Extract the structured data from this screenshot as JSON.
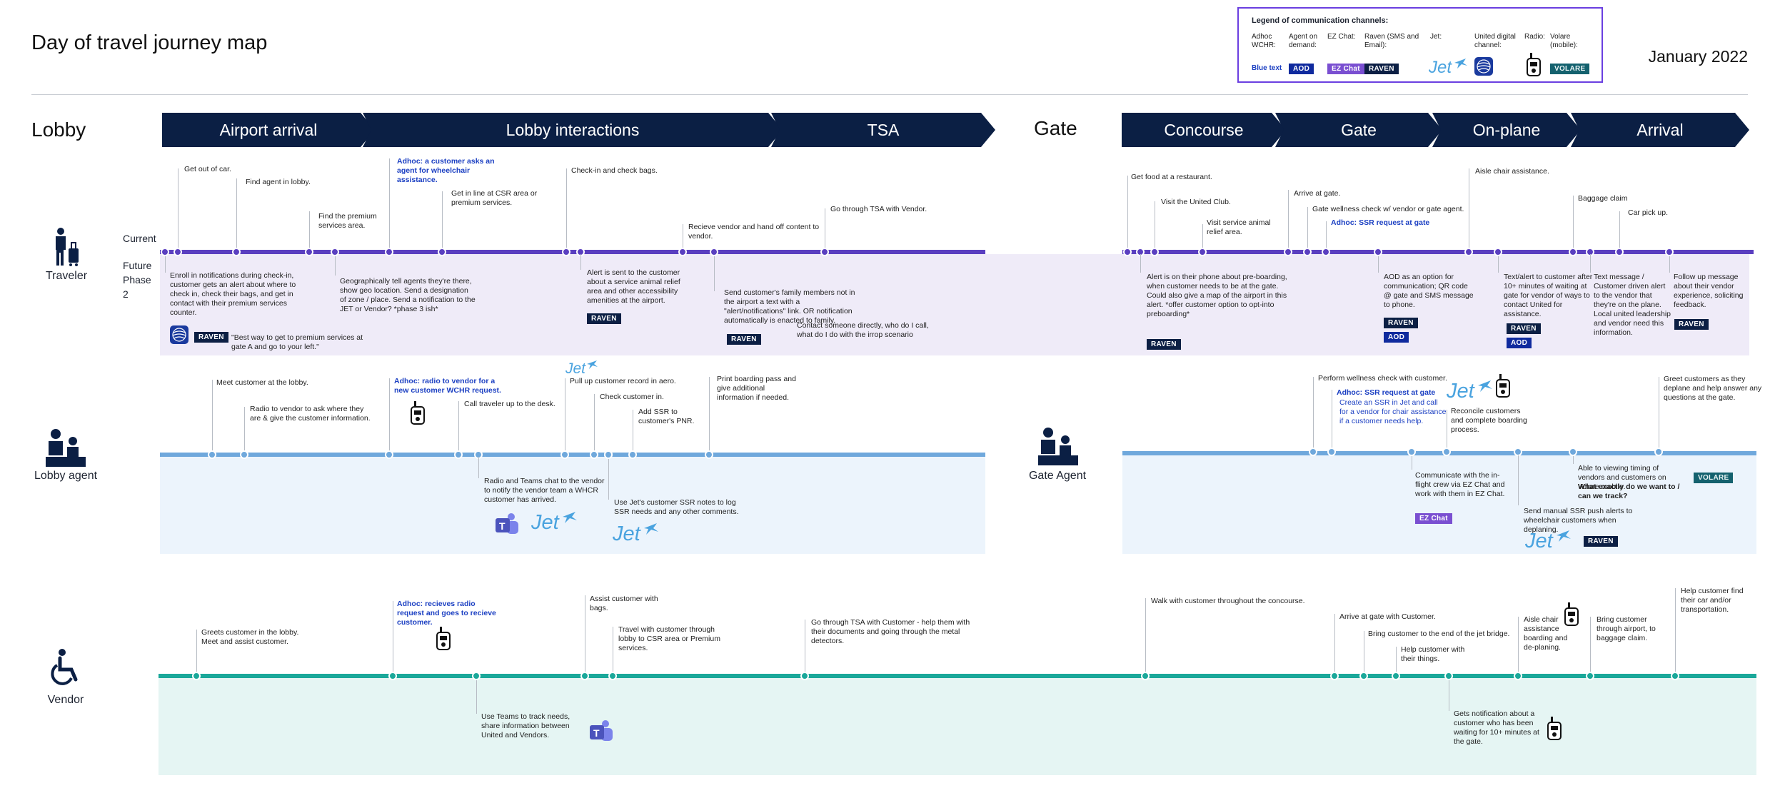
{
  "page": {
    "title": "Day of travel journey map",
    "date": "January 2022"
  },
  "legend": {
    "title": "Legend of communication channels:",
    "items": [
      {
        "label": "Adhoc WCHR:",
        "tag": "Blue text",
        "kind": "bluetext"
      },
      {
        "label": "Agent on demand:",
        "tag": "AOD",
        "kind": "aod"
      },
      {
        "label": "EZ Chat:",
        "tag": "EZ Chat",
        "kind": "ez"
      },
      {
        "label": "Raven (SMS and Email):",
        "tag": "RAVEN",
        "kind": "raven"
      },
      {
        "label": "Jet:",
        "tag": "Jet",
        "kind": "jet"
      },
      {
        "label": "United digital channel:",
        "tag": "",
        "kind": "united"
      },
      {
        "label": "Radio:",
        "tag": "",
        "kind": "radio"
      },
      {
        "label": "Volare (mobile):",
        "tag": "VOLARE",
        "kind": "volare"
      }
    ]
  },
  "sections": {
    "lobby": "Lobby",
    "gate": "Gate"
  },
  "stages": [
    "Airport arrival",
    "Lobby interactions",
    "TSA",
    "Concourse",
    "Gate",
    "On-plane",
    "Arrival"
  ],
  "rows": {
    "current": "Current",
    "future": "Future Phase 2"
  },
  "roles": {
    "traveler": "Traveler",
    "lobby_agent": "Lobby agent",
    "gate_agent": "Gate Agent",
    "vendor": "Vendor"
  },
  "colors": {
    "navy": "#0b1f44",
    "purple": "#5a3fc0",
    "lightblue": "#6fa8dc",
    "teal": "#1aa89a",
    "blue_text": "#1b3fc2"
  },
  "tags": {
    "raven": "RAVEN",
    "aod": "AOD",
    "ez": "EZ Chat",
    "volare": "VOLARE",
    "jet": "Jet"
  },
  "traveler": {
    "lobby_current": [
      "Get out of car.",
      "Find agent in lobby.",
      "Find the premium services area.",
      "Adhoc: a customer asks an agent for wheelchair assistance.",
      "Get in line at CSR area or premium services.",
      "Check-in and check bags.",
      "Recieve vendor and hand off content to vendor.",
      "Go through TSA with Vendor."
    ],
    "lobby_future": [
      "Enroll in notifications during check-in, customer gets an alert about where to check in, check their bags, and get in contact with their premium services counter.",
      "\"Best way to get to premium services at gate A and go to your left.\"",
      "Geographically tell agents they're there, show geo location. Send a designation of zone / place. Send a notification to the JET or Vendor? *phase 3 ish*",
      "Alert is sent to the customer about a service animal relief area and other accessibility amenities at the airport.",
      "Send customer's family members not in the airport a text with a \"alert/notifications\" link. OR notification automatically is enacted to family.",
      "Contact someone directly, who do I call, what do I do with the irrop scenario"
    ],
    "gate_current": [
      "Get food at a restaurant.",
      "Visit the United Club.",
      "Visit service animal relief area.",
      "Arrive at gate.",
      "Gate wellness check w/ vendor or gate agent.",
      "Adhoc: SSR request at gate",
      "Aisle chair assistance.",
      "Baggage claim",
      "Car pick up."
    ],
    "gate_future": [
      "Alert is on their phone about pre-boarding, when customer needs to be at the gate. Could also give a map of the airport in this alert. *offer customer option to opt-into preboarding*",
      "AOD as an option for communication; QR code @ gate and SMS message to phone.",
      "Text/alert to customer after 10+ minutes of waiting at gate for vendor of ways to contact United for assistance.",
      "Text message / Customer driven alert to the vendor that they're on the plane. Local united leadership and vendor need this information.",
      "Follow up message about their vendor experience, soliciting feedback."
    ]
  },
  "lobby_agent": {
    "above": [
      "Meet customer at the lobby.",
      "Radio to vendor to ask where they are & give the customer information.",
      "Adhoc: radio to vendor for a new customer WCHR request.",
      "Call traveler up to the desk.",
      "Pull up customer record in aero.",
      "Check customer in.",
      "Add SSR to customer's PNR.",
      "Print boarding pass and give additional information if needed."
    ],
    "below": [
      "Radio and Teams chat to the vendor to notify the vendor team a WHCR customer has arrived.",
      "Use Jet's customer SSR notes to log SSR needs and any other comments."
    ]
  },
  "gate_agent": {
    "above": [
      "Perform wellness check with customer.",
      "Adhoc: SSR request at gate",
      "Create an SSR in Jet and call for a vendor for chair assistance if a customer needs help.",
      "Reconcile customers and complete boarding process.",
      "Greet customers as they deplane and help answer any questions at the gate."
    ],
    "below": [
      "Communicate with the in-flight crew via EZ Chat and work with them in EZ Chat.",
      "Able to viewing timing of vendors and customers on Volare mobile.",
      "What exactly do we want to / can we track?",
      "Send manual SSR push alerts to wheelchair customers when deplaning."
    ]
  },
  "vendor": {
    "above": [
      "Greets customer in the lobby. Meet and assist customer.",
      "Adhoc: recieves radio request and goes to recieve customer.",
      "Assist customer with bags.",
      "Travel with customer through lobby to CSR area or Premium services.",
      "Go through TSA with Customer - help them with their documents and going through the metal detectors.",
      "Walk with customer throughout the concourse.",
      "Arrive at gate with Customer.",
      "Bring customer to the end of the jet bridge.",
      "Help customer with their things.",
      "Aisle chair assistance boarding and de-planing.",
      "Bring customer through airport, to baggage claim.",
      "Help customer find their car and/or transportation."
    ],
    "below": [
      "Use Teams to track needs, share information between United and Vendors.",
      "Gets notification about a customer who has been waiting for 10+ minutes at the gate."
    ]
  }
}
